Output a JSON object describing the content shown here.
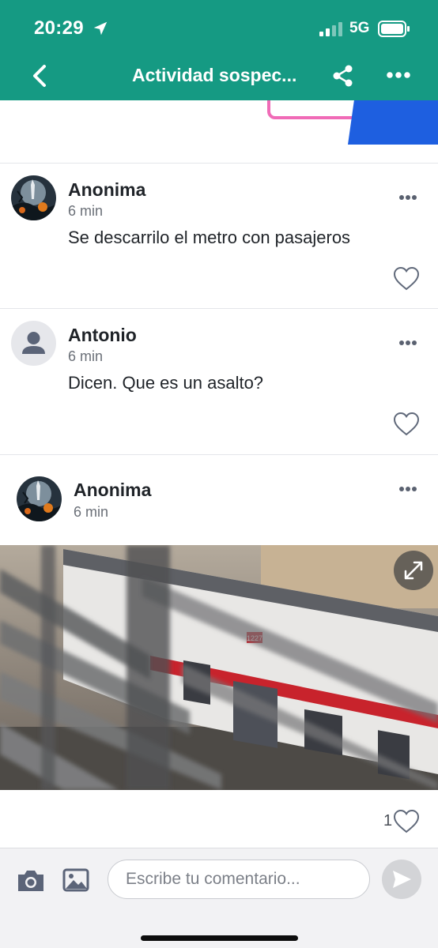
{
  "status_bar": {
    "time": "20:29",
    "network": "5G"
  },
  "header": {
    "title": "Actividad sospec..."
  },
  "comments": [
    {
      "name": "Anonima",
      "time": "6 min",
      "text": "Se descarrilo el metro con pasajeros"
    },
    {
      "name": "Antonio",
      "time": "6 min",
      "text": "Dicen. Que es un asalto?"
    }
  ],
  "post": {
    "name": "Anonima",
    "time": "6 min",
    "likes": "1",
    "image_label": "1227"
  },
  "composer": {
    "placeholder": "Escribe tu comentario..."
  },
  "colors": {
    "header_bg": "#159a83",
    "pink": "#f06bb7",
    "blue": "#1e5fe0"
  },
  "icons": [
    "location-arrow-icon",
    "signal-icon",
    "battery-icon",
    "back-arrow-icon",
    "share-icon",
    "more-icon",
    "heart-icon",
    "expand-icon",
    "camera-icon",
    "image-icon",
    "send-icon"
  ]
}
